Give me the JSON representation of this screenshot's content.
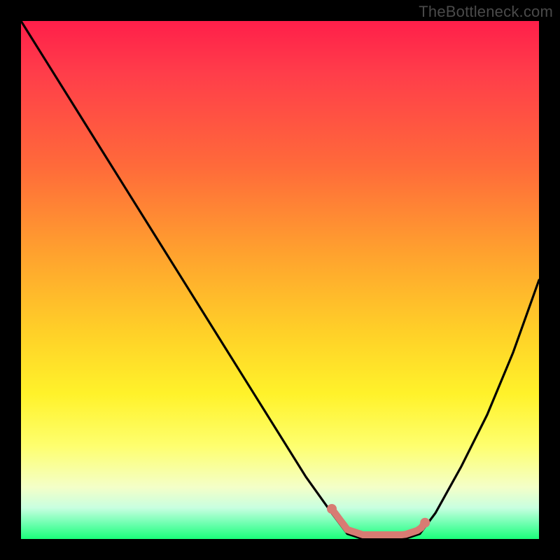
{
  "watermark": "TheBottleneck.com",
  "chart_data": {
    "type": "line",
    "title": "",
    "xlabel": "",
    "ylabel": "",
    "xlim": [
      0,
      100
    ],
    "ylim": [
      0,
      100
    ],
    "series": [
      {
        "name": "curve",
        "x": [
          0,
          5,
          10,
          15,
          20,
          25,
          30,
          35,
          40,
          45,
          50,
          55,
          60,
          63,
          66,
          70,
          74,
          77,
          80,
          85,
          90,
          95,
          100
        ],
        "values": [
          100,
          92,
          84,
          76,
          68,
          60,
          52,
          44,
          36,
          28,
          20,
          12,
          5,
          1,
          0,
          0,
          0,
          1,
          5,
          14,
          24,
          36,
          50
        ]
      }
    ],
    "highlight_band": {
      "x_start": 60,
      "x_end": 78,
      "color": "#d87b73"
    }
  }
}
